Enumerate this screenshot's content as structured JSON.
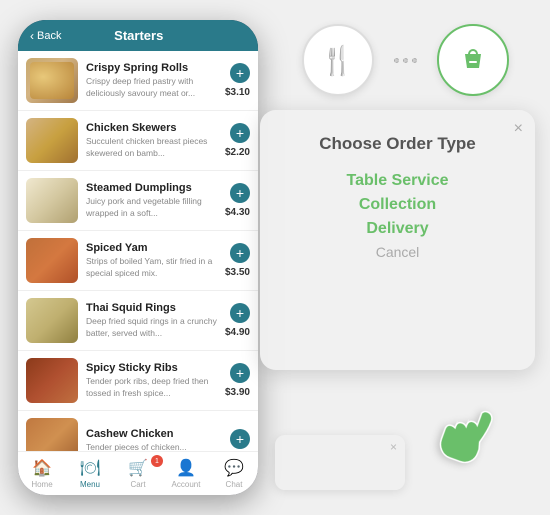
{
  "phone": {
    "header": {
      "back_label": "Back",
      "title": "Starters"
    },
    "menu_items": [
      {
        "name": "Crispy Spring Rolls",
        "desc": "Crispy deep fried pastry with deliciously savoury meat or...",
        "price": "$3.10",
        "img_class": "item-img-spring-rolls"
      },
      {
        "name": "Chicken Skewers",
        "desc": "Succulent chicken breast pieces skewered on bamb...",
        "price": "$2.20",
        "img_class": "item-img-chicken"
      },
      {
        "name": "Steamed Dumplings",
        "desc": "Juicy pork and vegetable filling wrapped in a soft...",
        "price": "$4.30",
        "img_class": "item-img-dumplings"
      },
      {
        "name": "Spiced Yam",
        "desc": "Strips of boiled Yam, stir fried in a special spiced mix.",
        "price": "$3.50",
        "img_class": "item-img-yam"
      },
      {
        "name": "Thai Squid Rings",
        "desc": "Deep fried squid rings in a crunchy batter, served with...",
        "price": "$4.90",
        "img_class": "item-img-squid"
      },
      {
        "name": "Spicy Sticky Ribs",
        "desc": "Tender pork ribs, deep fried then tossed in fresh spice...",
        "price": "$3.90",
        "img_class": "item-img-ribs"
      },
      {
        "name": "Cashew Chicken",
        "desc": "Tender pieces of chicken...",
        "price": "",
        "img_class": "item-img-cashew"
      }
    ],
    "nav": {
      "items": [
        {
          "label": "Home",
          "icon": "🏠",
          "active": false
        },
        {
          "label": "Menu",
          "icon": "🍽",
          "active": true
        },
        {
          "label": "Cart",
          "icon": "🛒",
          "active": false,
          "badge": "1"
        },
        {
          "label": "Account",
          "icon": "👤",
          "active": false
        },
        {
          "label": "Chat",
          "icon": "💬",
          "active": false
        }
      ]
    }
  },
  "modal": {
    "title": "Choose Order Type",
    "options": [
      {
        "label": "Table Service",
        "type": "primary"
      },
      {
        "label": "Collection",
        "type": "primary"
      },
      {
        "label": "Delivery",
        "type": "primary"
      },
      {
        "label": "Cancel",
        "type": "cancel"
      }
    ],
    "close_icon": "×"
  },
  "top_icons": {
    "fork_knife_label": "restaurant-icon",
    "bag_label": "shopping-bag-icon",
    "minus_on_bag": "−"
  }
}
